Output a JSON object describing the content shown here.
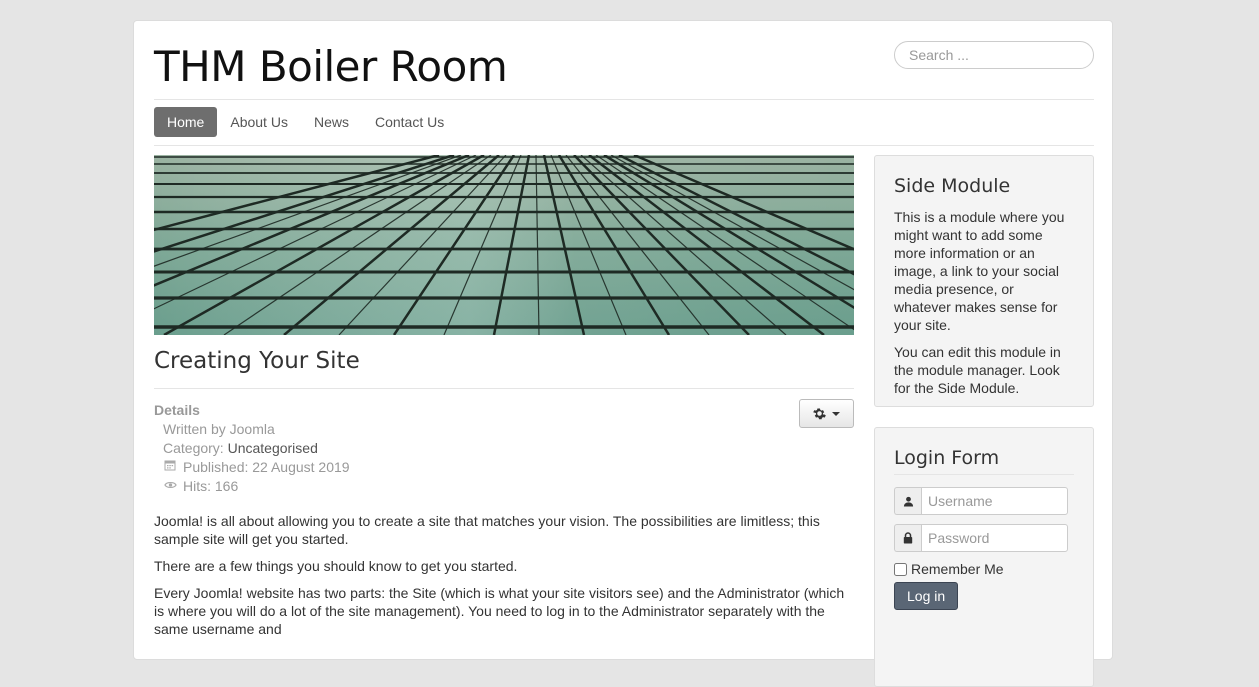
{
  "site": {
    "title": "THM Boiler Room"
  },
  "search": {
    "placeholder": "Search ..."
  },
  "nav": {
    "items": [
      "Home",
      "About Us",
      "News",
      "Contact Us"
    ],
    "active": "Home"
  },
  "banner": {
    "alt": "banner"
  },
  "article": {
    "title": "Creating Your Site",
    "details": {
      "heading": "Details",
      "written_by": "Written by Joomla",
      "category_label": "Category: ",
      "category": "Uncategorised",
      "published": "Published: 22 August 2019",
      "hits": "Hits: 166"
    },
    "paragraphs": [
      "Joomla! is all about allowing you to create a site that matches your vision. The possibilities are limitless; this sample site will get you started.",
      "There are a few things you should know to get you started.",
      "Every Joomla! website has two parts: the Site (which is what your site visitors see) and the Administrator (which is where you will do a lot of the site management). You need to log in to the Administrator separately with the same username and"
    ]
  },
  "side_module": {
    "title": "Side Module",
    "paragraphs": [
      "This is a module where you might want to add some more information or an image, a link to your social media presence, or whatever makes sense for your site.",
      "You can edit this module in the module manager. Look for the Side Module."
    ]
  },
  "login_form": {
    "title": "Login Form",
    "username_placeholder": "Username",
    "password_placeholder": "Password",
    "remember_label": "Remember Me",
    "button_label": "Log in"
  },
  "icons": {
    "tools": "gear-icon",
    "calendar": "calendar-icon",
    "hits": "eye-icon",
    "user": "user-icon",
    "lock": "lock-icon"
  },
  "colors": {
    "nav_active_bg": "#6e6e6e",
    "login_button_bg": "#5a6675",
    "page_bg": "#e5e5e5"
  }
}
